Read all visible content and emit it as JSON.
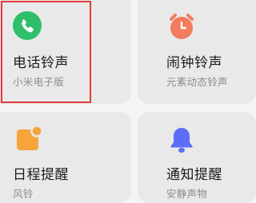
{
  "cards": [
    {
      "title": "电话铃声",
      "subtitle": "小米电子版",
      "icon": "phone-icon",
      "color": "#2fbf6b"
    },
    {
      "title": "闹钟铃声",
      "subtitle": "元素动态铃声",
      "icon": "alarm-clock-icon",
      "color": "#f27c5e"
    },
    {
      "title": "日程提醒",
      "subtitle": "风铃",
      "icon": "calendar-icon",
      "color": "#f5a53b"
    },
    {
      "title": "通知提醒",
      "subtitle": "安静声物",
      "icon": "bell-icon",
      "color": "#5b6ef5"
    }
  ],
  "selection_color": "#e43b3b"
}
